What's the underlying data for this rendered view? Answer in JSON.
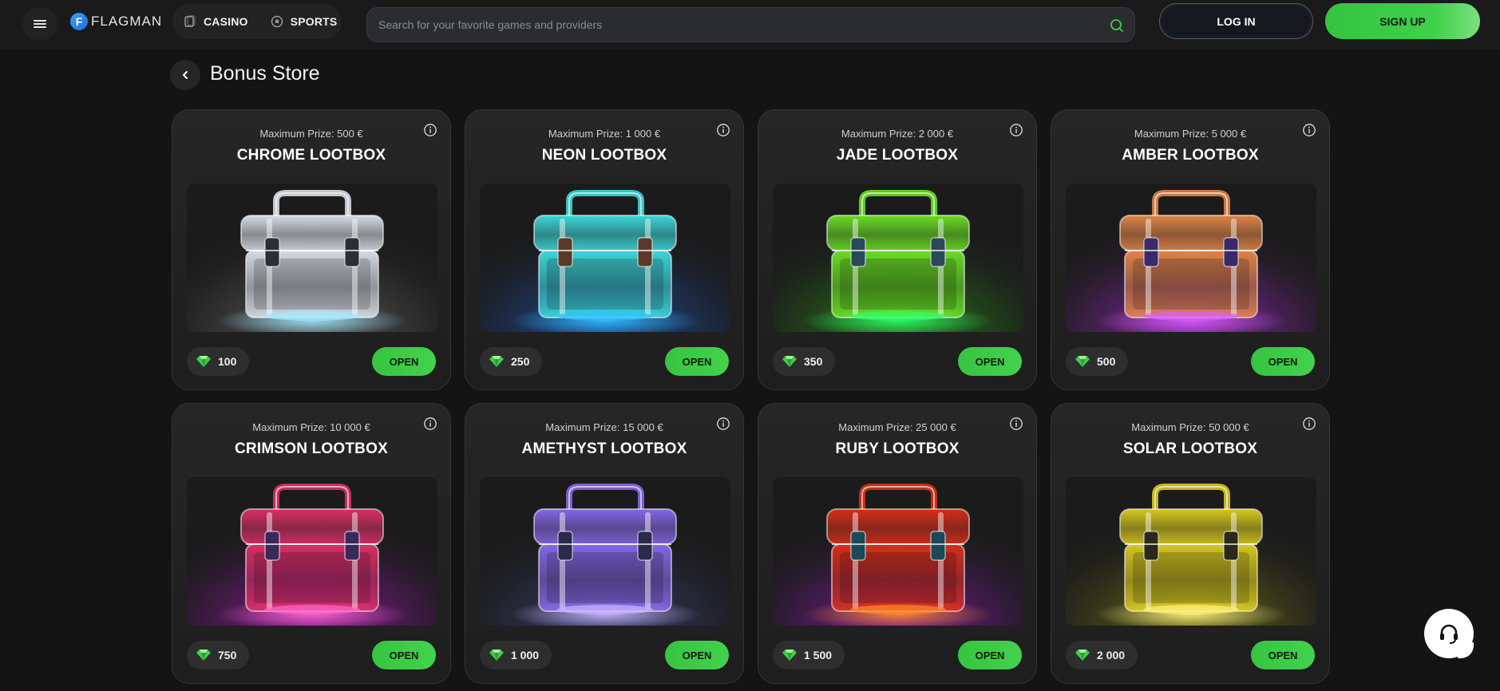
{
  "header": {
    "logo_letter": "F",
    "logo_text": "FLAGMAN",
    "nav": [
      {
        "label": "CASINO",
        "icon": "casino-chip-icon"
      },
      {
        "label": "SPORTS",
        "icon": "soccer-ball-icon"
      }
    ],
    "search_placeholder": "Search for your favorite games and providers",
    "login_label": "LOG IN",
    "signup_label": "SIGN UP"
  },
  "page": {
    "title": "Bonus Store"
  },
  "colors": {
    "accent": "#3fce48",
    "background": "#141414",
    "card": "#232323"
  },
  "lootboxes": [
    {
      "prize": "Maximum Prize: 500 €",
      "name": "CHROME LOOTBOX",
      "cost": "100",
      "open": "OPEN",
      "tint": "#dfe6ee",
      "glow": "#9ee8ff",
      "floor": "#5a5a5a",
      "clasp": "#2a2f35"
    },
    {
      "prize": "Maximum Prize: 1 000 €",
      "name": "NEON LOOTBOX",
      "cost": "250",
      "open": "OPEN",
      "tint": "#3fe0e0",
      "glow": "#30c0ff",
      "floor": "#1e4a9a",
      "clasp": "#5a3a2a"
    },
    {
      "prize": "Maximum Prize: 2 000 €",
      "name": "JADE LOOTBOX",
      "cost": "350",
      "open": "OPEN",
      "tint": "#6ee626",
      "glow": "#2aff6a",
      "floor": "#2a7a1a",
      "clasp": "#2a4a5a"
    },
    {
      "prize": "Maximum Prize: 5 000 €",
      "name": "AMBER LOOTBOX",
      "cost": "500",
      "open": "OPEN",
      "tint": "#e88a4a",
      "glow": "#d85cff",
      "floor": "#8a2aaa",
      "clasp": "#3a2a6a"
    },
    {
      "prize": "Maximum Prize: 10 000 €",
      "name": "CRIMSON LOOTBOX",
      "cost": "750",
      "open": "OPEN",
      "tint": "#e2306a",
      "glow": "#ff66cc",
      "floor": "#8a1a9a",
      "clasp": "#3a2a5a"
    },
    {
      "prize": "Maximum Prize: 15 000 €",
      "name": "AMETHYST LOOTBOX",
      "cost": "1 000",
      "open": "OPEN",
      "tint": "#8a6cf0",
      "glow": "#c8b8ff",
      "floor": "#3a3a6a",
      "clasp": "#2a2a4a"
    },
    {
      "prize": "Maximum Prize: 25 000 €",
      "name": "RUBY LOOTBOX",
      "cost": "1 500",
      "open": "OPEN",
      "tint": "#e0301a",
      "glow": "#ff8a2a",
      "floor": "#7a1a9a",
      "clasp": "#1a4a5a"
    },
    {
      "prize": "Maximum Prize: 50 000 €",
      "name": "SOLAR LOOTBOX",
      "cost": "2 000",
      "open": "OPEN",
      "tint": "#e0d020",
      "glow": "#fff27a",
      "floor": "#6a6a1a",
      "clasp": "#2a2a1a"
    }
  ]
}
